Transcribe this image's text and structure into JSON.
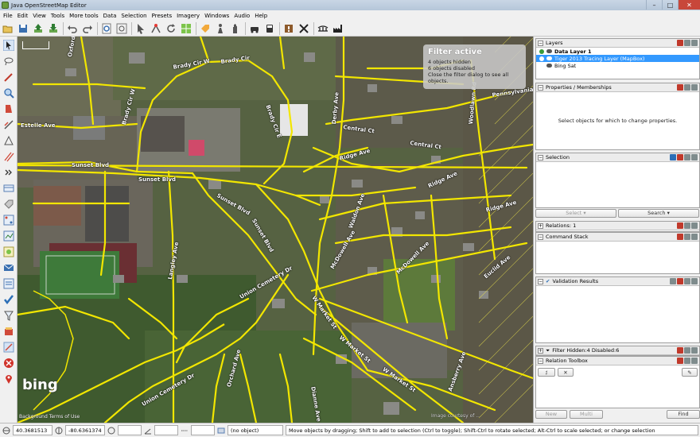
{
  "window": {
    "title": "Java OpenStreetMap Editor",
    "minimize": "–",
    "maximize": "□",
    "close": "✕"
  },
  "menu": [
    "File",
    "Edit",
    "View",
    "Tools",
    "More tools",
    "Data",
    "Selection",
    "Presets",
    "Imagery",
    "Windows",
    "Audio",
    "Help"
  ],
  "filter_overlay": {
    "title": "Filter active",
    "hidden": "4 objects hidden",
    "disabled": "6 objects disabled",
    "hint": "Close the filter dialog to see all objects."
  },
  "map": {
    "attribution_logo": "bing",
    "attribution_links": "Background Terms of Use",
    "imagery_credit": "Image courtesy of ...",
    "street_labels": [
      "Oxford Blvd",
      "Brady Cir W",
      "Brady Cir",
      "Brady Cir W",
      "Brady Cir E",
      "Estelle Ave",
      "Sunset Blvd",
      "Sunset Blvd",
      "Sunset Blvd",
      "Sunset Blvd",
      "Ridge Ave",
      "Central Ct",
      "Central Ct",
      "Ridge Ave",
      "Ridge Ave",
      "Langley Ave",
      "Union Cemetery Dr",
      "Union Cemetery Dr",
      "W Market St",
      "W Market St",
      "W Market St",
      "McDowell Ave",
      "McDowell Ave",
      "Euclid Ave",
      "Woodlawn Rd",
      "Pennsylvania Ave",
      "Orchard Ave",
      "Dianne Ave",
      "Waldon Ave",
      "Derby Ave",
      "Ansberry Ave"
    ]
  },
  "panels": {
    "layers": {
      "title": "Layers",
      "items": [
        {
          "name": "Data Layer 1",
          "selected": false,
          "bold": true
        },
        {
          "name": "Tiger 2013 Tracing Layer (MapBox)",
          "selected": true,
          "bold": false
        },
        {
          "name": "Bing Sat",
          "selected": false,
          "bold": false
        }
      ]
    },
    "properties": {
      "title": "Properties / Memberships",
      "empty_text": "Select objects for which to change properties."
    },
    "selection": {
      "title": "Selection",
      "select_button": "Select",
      "search_button": "Search"
    },
    "relations": {
      "title": "Relations: 1"
    },
    "command_stack": {
      "title": "Command Stack"
    },
    "validation": {
      "title": "Validation Results"
    },
    "filter": {
      "title": "Filter Hidden:4 Disabled:6"
    },
    "relation_toolbox": {
      "title": "Relation Toolbox",
      "new_button": "New",
      "multi_button": "Multi",
      "find_button": "Find"
    }
  },
  "status": {
    "lat": "40.3681513",
    "lon": "-80.6361374",
    "angle": "",
    "length": "",
    "object": "(no object)",
    "help": "Move objects by dragging; Shift to add to selection (Ctrl to toggle); Shift-Ctrl to rotate selected; Alt-Ctrl to scale selected; or change selection"
  },
  "colors": {
    "road": "#f2e600",
    "selection_highlight": "#3399ff",
    "filter_title": "#ffffff",
    "map_dark": "#4e5a3a"
  },
  "icons": {
    "toolbar": [
      "open-icon",
      "save-icon",
      "upload-icon",
      "download-icon",
      "undo-icon",
      "redo-icon",
      "preferences-icon",
      "zoom-icon",
      "cursor-icon",
      "node-icon",
      "refresh-icon",
      "grid-icon",
      "tag-icon",
      "person-icon",
      "hand-icon",
      "car-icon",
      "bus-icon",
      "warning-icon",
      "cross-icon",
      "bridge-icon",
      "factory-icon"
    ],
    "left_tools": [
      "select-icon",
      "lasso-icon",
      "draw-icon",
      "zoom-icon",
      "delete-icon",
      "extrude-icon",
      "improve-icon",
      "parallel-icon",
      "more-icon",
      "layer-icon",
      "tag-icon",
      "relation-icon",
      "history-icon",
      "filter-icon",
      "conflict-icon",
      "validate-icon",
      "notes-icon",
      "todo-icon",
      "preset-icon",
      "map-paint-icon",
      "stop-icon",
      "location-icon"
    ]
  }
}
